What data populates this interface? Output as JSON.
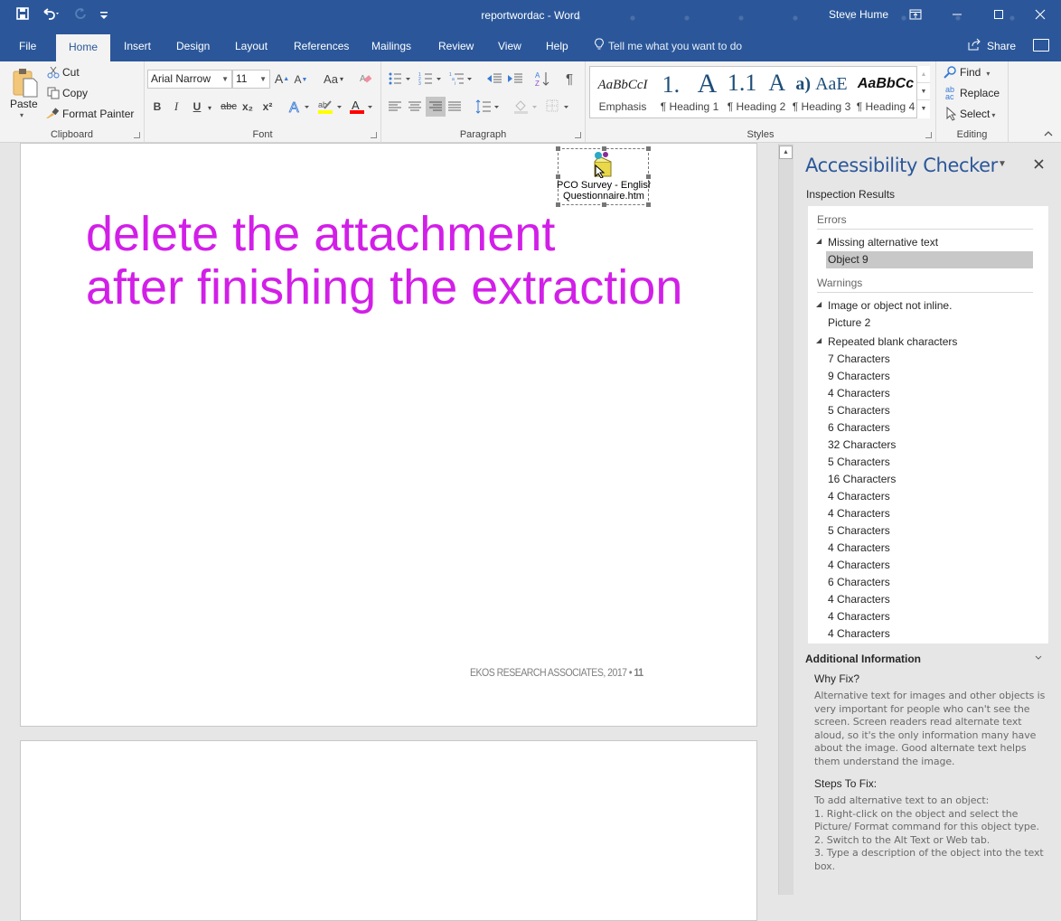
{
  "titlebar": {
    "title": "reportwordac  -  Word",
    "user": "Steve Hume",
    "qat": {
      "save": "save-icon",
      "undo": "undo-icon",
      "redo": "redo-icon",
      "customize": "customize-qat-icon"
    },
    "window_buttons": {
      "ribbon_display": "ribbon-display-options",
      "minimize": "minimize",
      "maximize": "maximize",
      "close": "close"
    }
  },
  "tabs": [
    {
      "label": "File"
    },
    {
      "label": "Home"
    },
    {
      "label": "Insert"
    },
    {
      "label": "Design"
    },
    {
      "label": "Layout"
    },
    {
      "label": "References"
    },
    {
      "label": "Mailings"
    },
    {
      "label": "Review"
    },
    {
      "label": "View"
    },
    {
      "label": "Help"
    }
  ],
  "active_tab": "Home",
  "tellme": "Tell me what you want to do",
  "share": "Share",
  "ribbon": {
    "clipboard": {
      "label": "Clipboard",
      "paste": "Paste",
      "cut": "Cut",
      "copy": "Copy",
      "format_painter": "Format Painter"
    },
    "font": {
      "label": "Font",
      "font_name": "Arial Narrow",
      "font_size": "11",
      "change_case": "Aa",
      "bold": "B",
      "italic": "I",
      "underline": "U",
      "strike": "abc",
      "subscript": "x₂",
      "superscript": "x²",
      "highlight_color": "#ffff00",
      "font_color": "#ff0000"
    },
    "paragraph": {
      "label": "Paragraph",
      "pilcrow": "¶"
    },
    "styles": {
      "label": "Styles",
      "items": [
        {
          "preview": "AaBbCcI",
          "name": "Emphasis"
        },
        {
          "preview": "1.",
          "name": "¶ Heading 1"
        },
        {
          "preview": "A",
          "name": ""
        },
        {
          "preview": "1.1",
          "name": "¶ Heading 2"
        },
        {
          "preview": "A",
          "name": ""
        },
        {
          "preview": "a)",
          "name": "¶ Heading 3"
        },
        {
          "preview": "AaE",
          "name": ""
        },
        {
          "preview": "AaBbCc",
          "name": "¶ Heading 4"
        }
      ]
    },
    "editing": {
      "label": "Editing",
      "find": "Find",
      "replace": "Replace",
      "select": "Select"
    }
  },
  "document": {
    "instruction_line1": "delete the attachment",
    "instruction_line2": "after finishing the extraction",
    "object_caption_line1": "PCO Survey - English",
    "object_caption_line2": "Questionnaire.htm",
    "footer_text": "EKOS RESEARCH ASSOCIATES, 2017 • ",
    "page_number": "11",
    "text_color": "#d21fe8"
  },
  "pane": {
    "title": "Accessibility Checker",
    "inspection_results": "Inspection Results",
    "errors_label": "Errors",
    "errors": [
      {
        "issue": "Missing alternative text",
        "items": [
          "Object 9"
        ],
        "selected": "Object 9"
      }
    ],
    "warnings_label": "Warnings",
    "warnings": [
      {
        "issue": "Image or object not inline.",
        "items": [
          "Picture 2"
        ]
      },
      {
        "issue": "Repeated blank characters",
        "items": [
          "7 Characters",
          "9 Characters",
          "4 Characters",
          "5 Characters",
          "6 Characters",
          "32 Characters",
          "5 Characters",
          "16 Characters",
          "4 Characters",
          "4 Characters",
          "5 Characters",
          "4 Characters",
          "4 Characters",
          "6 Characters",
          "4 Characters",
          "4 Characters",
          "4 Characters"
        ]
      }
    ],
    "additional_info": "Additional Information",
    "why_fix_label": "Why Fix?",
    "why_fix_text": "Alternative text for images and other objects is very important for people who can't see the screen. Screen readers read alternate text aloud, so it's the only information many have about the image. Good alternate text helps them understand the image.",
    "steps_label": "Steps To Fix:",
    "steps_intro": "To add alternative text to an object:",
    "steps": [
      "1. Right-click on the object and select the Picture/ Format command for this object type.",
      "2. Switch to the Alt Text or Web tab.",
      "3. Type a description of the object into the text box."
    ]
  }
}
